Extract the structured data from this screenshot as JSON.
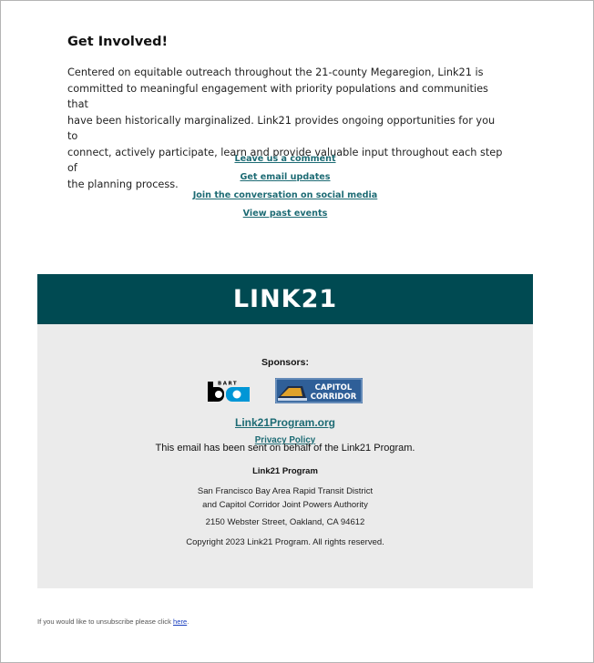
{
  "intro": {
    "heading": "Get Involved!",
    "line1": "Centered on equitable outreach throughout the 21-county Megaregion, Link21 is",
    "line2": "committed to meaningful engagement with priority populations and communities that",
    "line3": "have been historically marginalized. Link21 provides ongoing opportunities for you to",
    "line4": "connect, actively participate, learn and provide valuable input throughout each step of",
    "line5": "the planning process."
  },
  "links": {
    "comment": "Leave us a comment",
    "email": "Get email updates",
    "social": "Join the conversation on social media",
    "events": "View past events"
  },
  "banner": {
    "logo_left": "LIN",
    "logo_k": "K",
    "logo_right": "21",
    "color": "#004a52"
  },
  "footer": {
    "sponsors_label": "Sponsors:",
    "bart_logo_letters": "BART",
    "cc_logo_line1": "CAPITOL",
    "cc_logo_line2": "CORRIDOR",
    "site_link": "Link21Program.org",
    "privacy_link": "Privacy Policy",
    "behalf_text": "This email has been sent on behalf of the Link21 Program.",
    "program_name": "Link21 Program",
    "org_line1": "San Francisco Bay Area Rapid Transit District",
    "org_line2": "and Capitol Corridor Joint Powers Authority",
    "address": "2150 Webster Street, Oakland, CA 94612",
    "copyright": "Copyright 2023 Link21 Program. All rights reserved."
  },
  "unsubscribe": {
    "text": "If you would like to unsubscribe please click ",
    "link": "here",
    "period": "."
  }
}
